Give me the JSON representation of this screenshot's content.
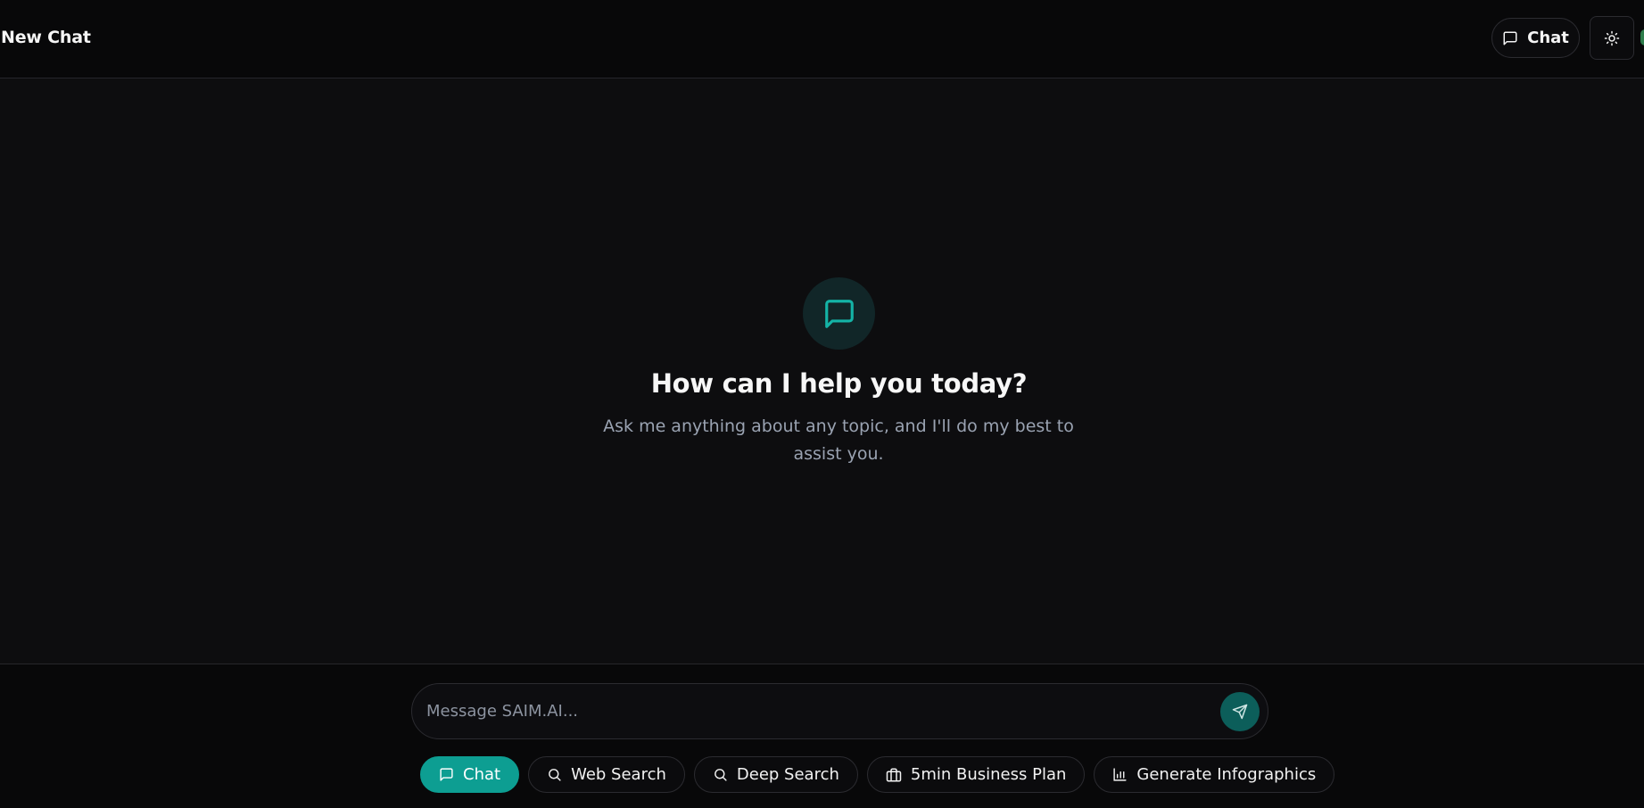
{
  "header": {
    "title": "New Chat",
    "chat_button_label": "Chat",
    "chat_button_icon": "message-square-icon",
    "theme_button_icon": "sun-icon"
  },
  "hero": {
    "icon": "message-square-icon",
    "title": "How can I help you today?",
    "subtitle": "Ask me anything about any topic, and I'll do my best to assist you."
  },
  "composer": {
    "placeholder": "Message SAIM.AI...",
    "value": "",
    "send_icon": "send-icon",
    "modes": [
      {
        "label": "Chat",
        "icon": "message-square-icon",
        "active": true
      },
      {
        "label": "Web Search",
        "icon": "search-icon",
        "active": false
      },
      {
        "label": "Deep Search",
        "icon": "search-icon",
        "active": false
      },
      {
        "label": "5min Business Plan",
        "icon": "briefcase-icon",
        "active": false
      },
      {
        "label": "Generate Infographics",
        "icon": "bar-chart-icon",
        "active": false
      }
    ]
  },
  "colors": {
    "background": "#0d0d0f",
    "header_background": "#080809",
    "accent": "#0d9e92",
    "send_button": "#0c5e5a",
    "hero_icon_background": "#112628",
    "subtitle_text": "#9aa3b2"
  }
}
